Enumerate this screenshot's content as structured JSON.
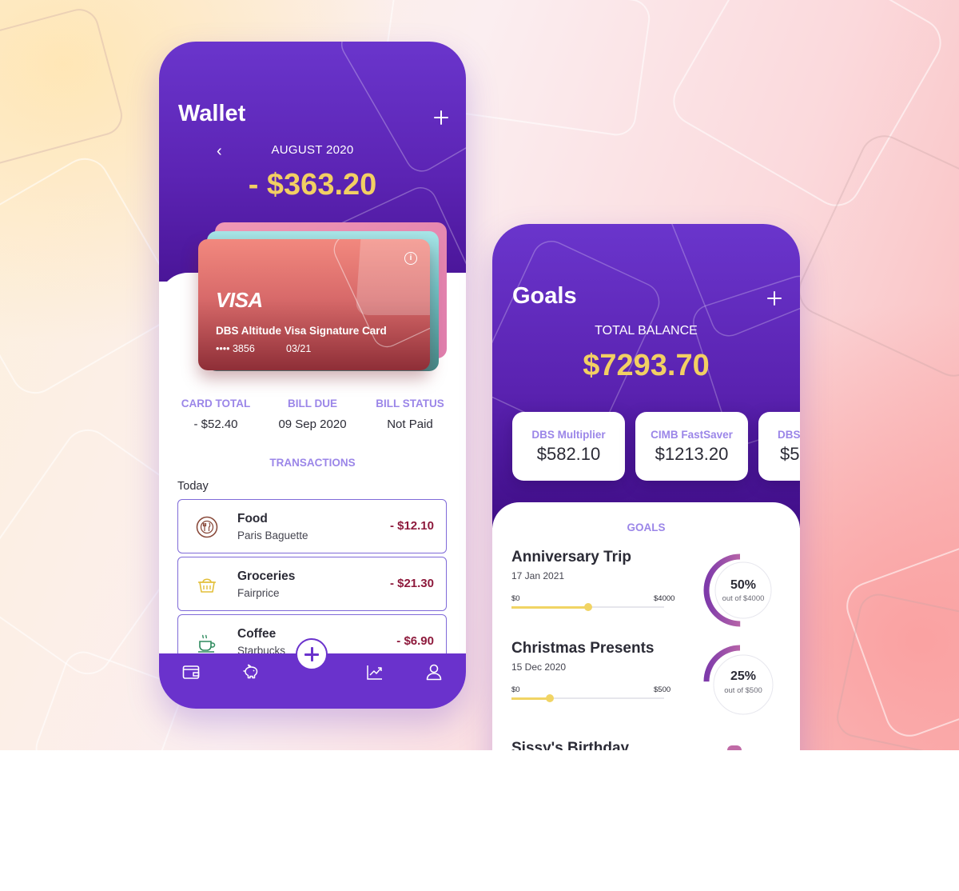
{
  "wallet": {
    "title": "Wallet",
    "month": "AUGUST 2020",
    "amount": "- $363.20",
    "card": {
      "brand": "VISA",
      "name": "DBS Altitude Visa Signature Card",
      "number": "•••• 3856",
      "expiry": "03/21"
    },
    "stats": [
      {
        "label": "CARD TOTAL",
        "value": "- $52.40"
      },
      {
        "label": "BILL DUE",
        "value": "09 Sep 2020"
      },
      {
        "label": "BILL STATUS",
        "value": "Not Paid"
      }
    ],
    "transactions_label": "TRANSACTIONS",
    "group_label": "Today",
    "transactions": [
      {
        "name": "Food",
        "merchant": "Paris Baguette",
        "amount": "- $12.10",
        "icon": "food-icon"
      },
      {
        "name": "Groceries",
        "merchant": "Fairprice",
        "amount": "- $21.30",
        "icon": "groceries-icon"
      },
      {
        "name": "Coffee",
        "merchant": "Starbucks",
        "amount": "- $6.90",
        "icon": "coffee-icon"
      }
    ],
    "nav": [
      "wallet-icon",
      "piggy-bank-icon",
      "add-icon",
      "trend-icon",
      "profile-icon"
    ]
  },
  "goals": {
    "title": "Goals",
    "balance_label": "TOTAL BALANCE",
    "balance": "$7293.70",
    "accounts": [
      {
        "name": "DBS Multiplier",
        "value": "$582.10"
      },
      {
        "name": "CIMB FastSaver",
        "value": "$1213.20"
      },
      {
        "name": "DBS",
        "value": "$5"
      }
    ],
    "section_label": "GOALS",
    "items": [
      {
        "name": "Anniversary Trip",
        "date": "17 Jan 2021",
        "min": "$0",
        "max": "$4000",
        "progress": 0.5,
        "pct": "50%",
        "sub": "out of $4000"
      },
      {
        "name": "Christmas Presents",
        "date": "15 Dec 2020",
        "min": "$0",
        "max": "$500",
        "progress": 0.25,
        "pct": "25%",
        "sub": "out of $500"
      },
      {
        "name": "Sissy's Birthday"
      }
    ]
  },
  "colors": {
    "purple": "#6a32cc",
    "gold": "#f2cf63",
    "lavender": "#9b86e8",
    "negative": "#8e1a3c"
  }
}
